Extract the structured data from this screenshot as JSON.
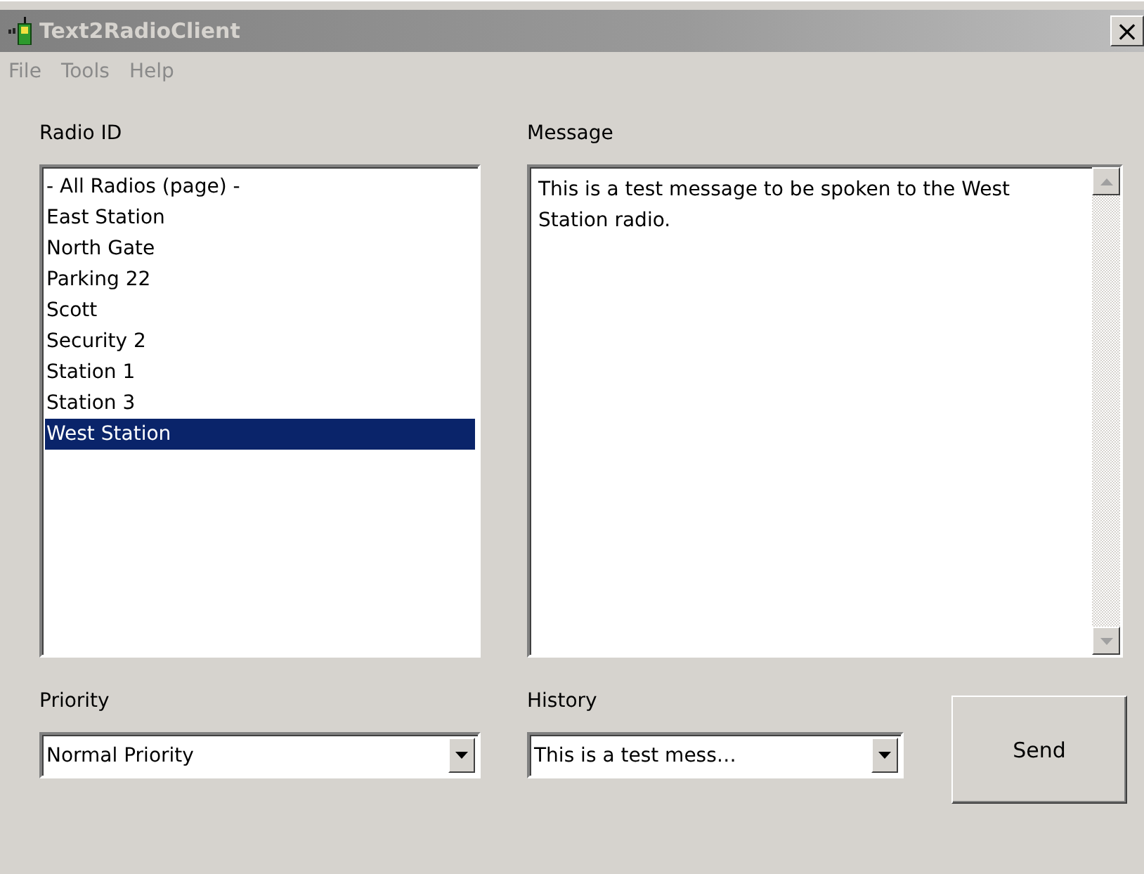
{
  "window": {
    "title": "Text2RadioClient",
    "close": "×"
  },
  "menu": [
    "File",
    "Tools",
    "Help"
  ],
  "radio_id": {
    "label": "Radio ID",
    "items": [
      {
        "label": "- All Radios (page) -",
        "selected": false
      },
      {
        "label": "East Station",
        "selected": false
      },
      {
        "label": "North Gate",
        "selected": false
      },
      {
        "label": "Parking 22",
        "selected": false
      },
      {
        "label": "Scott",
        "selected": false
      },
      {
        "label": "Security 2",
        "selected": false
      },
      {
        "label": "Station 1",
        "selected": false
      },
      {
        "label": "Station 3",
        "selected": false
      },
      {
        "label": "West Station",
        "selected": true
      }
    ]
  },
  "message": {
    "label": "Message",
    "value": "This is a test message to be spoken to the West Station radio."
  },
  "priority": {
    "label": "Priority",
    "value": "Normal Priority"
  },
  "history": {
    "label": "History",
    "value": "This is a test mess…"
  },
  "buttons": [
    "Send"
  ]
}
